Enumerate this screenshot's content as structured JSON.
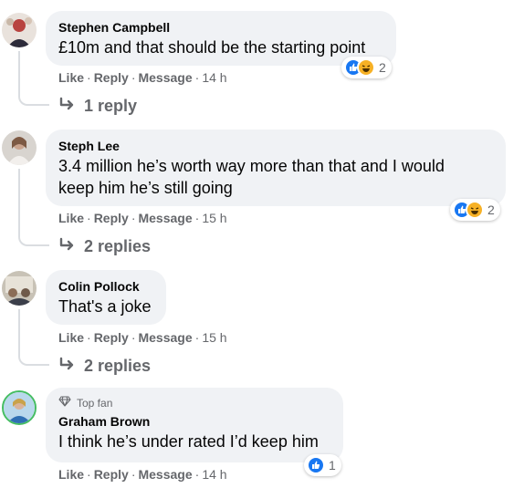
{
  "comments": [
    {
      "name": "Stephen Campbell",
      "text": "£10m and that should be the starting point",
      "actions": {
        "like": "Like",
        "reply": "Reply",
        "message": "Message",
        "sep": "·",
        "time": "14 h"
      },
      "reaction_count": "2",
      "reactions": [
        "like-icon",
        "haha-icon"
      ],
      "replies": "1 reply"
    },
    {
      "name": "Steph Lee",
      "text_line1": "3.4 million he’s worth way more than that and I would",
      "text_line2": "keep him he’s still going",
      "actions": {
        "like": "Like",
        "reply": "Reply",
        "message": "Message",
        "sep": "·",
        "time": "15 h"
      },
      "reaction_count": "2",
      "reactions": [
        "like-icon",
        "haha-icon"
      ],
      "replies": "2 replies"
    },
    {
      "name": "Colin Pollock",
      "text": "That's a joke",
      "actions": {
        "like": "Like",
        "reply": "Reply",
        "message": "Message",
        "sep": "·",
        "time": "15 h"
      },
      "replies": "2 replies"
    },
    {
      "badge": "Top fan",
      "name": "Graham Brown",
      "text": "I think he’s under rated I’d keep him",
      "actions": {
        "like": "Like",
        "reply": "Reply",
        "message": "Message",
        "sep": "·",
        "time": "14 h"
      },
      "reaction_count": "1",
      "reactions": [
        "like-icon"
      ]
    }
  ],
  "colors": {
    "bubble": "#f0f2f5",
    "meta": "#65676b",
    "like_blue": "#1877f2",
    "haha_yellow": "#f7b125"
  }
}
